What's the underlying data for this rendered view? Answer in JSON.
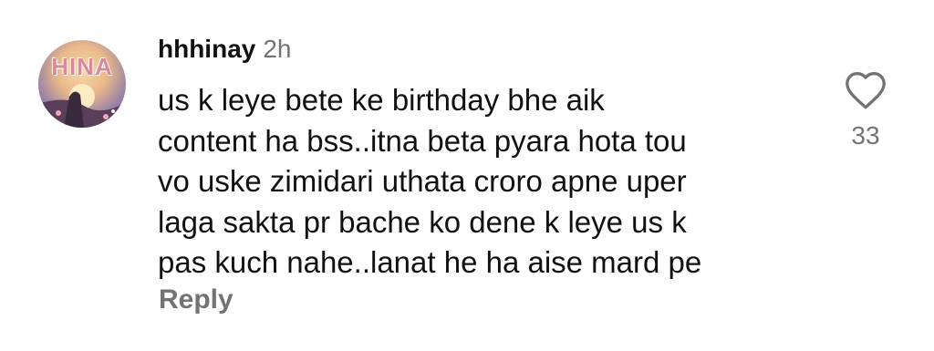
{
  "comment": {
    "avatar": {
      "text": "HINA",
      "icon": "profile-photo"
    },
    "username": "hhhinay",
    "timestamp": "2h",
    "text_lines": [
      "us k leye bete ke birthday bhe aik",
      "content ha bss..itna beta pyara hota tou",
      "vo uske zimidari uthata croro apne uper",
      "laga sakta pr bache ko dene k leye us k",
      "pas kuch nahe..lanat he ha aise mard pe"
    ],
    "reply_label": "Reply",
    "like": {
      "icon": "heart-outline-icon",
      "count": "33"
    }
  },
  "colors": {
    "text": "#111111",
    "muted": "#737373",
    "background": "#ffffff"
  }
}
